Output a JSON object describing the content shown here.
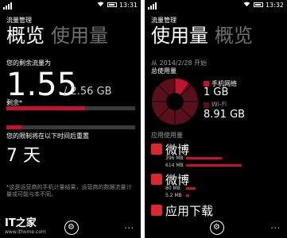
{
  "left": {
    "status": {
      "time": "13:31"
    },
    "app_title": "流量管理",
    "pivot": {
      "active": "概览",
      "inactive": "使用量"
    },
    "remaining_label": "您的剩余流量为",
    "remaining_value": "1.55",
    "remaining_total": "/ 2.56 GB",
    "remaining_fraction": 0.61,
    "remaining_caption": "剩余*",
    "reset_label": "您的限制将在以下时间后重置",
    "reset_fraction": 0.12,
    "reset_days": "7 天",
    "note": "*这是运营商的手机计量结果，运营商的数据流量计量或可能与本不同。",
    "watermark": {
      "logo": "IT之家",
      "url": "www.ithome.com"
    },
    "appbar": {
      "settings_icon": "gear-icon",
      "more": "..."
    }
  },
  "right": {
    "status": {
      "time": "13:32"
    },
    "app_title": "流量管理",
    "pivot": {
      "active": "使用量",
      "inactive": "概览"
    },
    "period_label": "从 2014/2/28 开始",
    "total_label": "总使用量",
    "mobile_label": "手机网络",
    "mobile_value": "1 GB",
    "wifi_label": "Wi-Fi",
    "wifi_value": "8.91 GB",
    "section_label": "应用使用量",
    "apps": [
      {
        "name": "微博",
        "line1": "396 MB",
        "line2": "614 MB",
        "frac1": 0.45,
        "frac2": 0.7
      },
      {
        "name": "微博",
        "line1": "80 MB",
        "line2": "5.2 MB",
        "frac1": 0.12,
        "frac2": 0.04
      },
      {
        "name": "应用下载"
      }
    ],
    "colors": {
      "accent": "#c4112e",
      "wifi": "#5a0f1c"
    },
    "appbar": {
      "settings_icon": "gear-icon",
      "more": "..."
    }
  }
}
